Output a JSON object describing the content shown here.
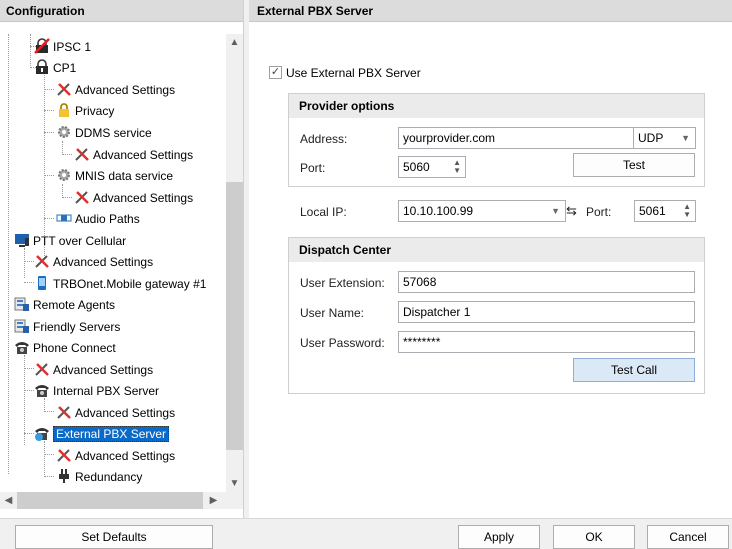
{
  "left_panel": {
    "title": "Configuration"
  },
  "right_panel": {
    "title": "External PBX Server"
  },
  "tree": [
    {
      "label": "IPSC 1",
      "icon": "lock-red-icon"
    },
    {
      "label": "CP1",
      "icon": "lock-black-icon"
    },
    {
      "label": "Advanced Settings",
      "icon": "tools-icon"
    },
    {
      "label": "Privacy",
      "icon": "padlock-icon"
    },
    {
      "label": "DDMS service",
      "icon": "gear-icon"
    },
    {
      "label": "Advanced Settings",
      "icon": "tools-icon"
    },
    {
      "label": "MNIS data service",
      "icon": "gear-icon"
    },
    {
      "label": "Advanced Settings",
      "icon": "tools-icon"
    },
    {
      "label": "Audio Paths",
      "icon": "audio-paths-icon"
    },
    {
      "label": "PTT over Cellular",
      "icon": "monitor-icon"
    },
    {
      "label": "Advanced Settings",
      "icon": "tools-icon"
    },
    {
      "label": "TRBOnet.Mobile gateway #1",
      "icon": "phone-icon"
    },
    {
      "label": "Remote Agents",
      "icon": "agents-icon"
    },
    {
      "label": "Friendly Servers",
      "icon": "agents-icon"
    },
    {
      "label": "Phone Connect",
      "icon": "telephone-icon"
    },
    {
      "label": "Advanced Settings",
      "icon": "tools-icon"
    },
    {
      "label": "Internal PBX Server",
      "icon": "telephone-icon"
    },
    {
      "label": "Advanced Settings",
      "icon": "tools-icon"
    },
    {
      "label": "External PBX Server",
      "icon": "telephone-globe-icon"
    },
    {
      "label": "Advanced Settings",
      "icon": "tools-icon"
    },
    {
      "label": "Redundancy",
      "icon": "plug-icon"
    }
  ],
  "use_external": {
    "label": "Use External PBX Server",
    "checked": true
  },
  "provider": {
    "title": "Provider options",
    "address_label": "Address:",
    "address_value": "yourprovider.com",
    "protocol": "UDP",
    "port_label": "Port:",
    "port_value": "5060",
    "test_label": "Test"
  },
  "local": {
    "ip_label": "Local IP:",
    "ip_value": "10.10.100.99",
    "port_label": "Port:",
    "port_value": "5061"
  },
  "dispatch": {
    "title": "Dispatch Center",
    "ext_label": "User Extension:",
    "ext_value": "57068",
    "name_label": "User Name:",
    "name_value": "Dispatcher 1",
    "pass_label": "User Password:",
    "pass_value": "********",
    "test_call_label": "Test Call"
  },
  "footer": {
    "set_defaults": "Set Defaults",
    "apply": "Apply",
    "ok": "OK",
    "cancel": "Cancel"
  }
}
